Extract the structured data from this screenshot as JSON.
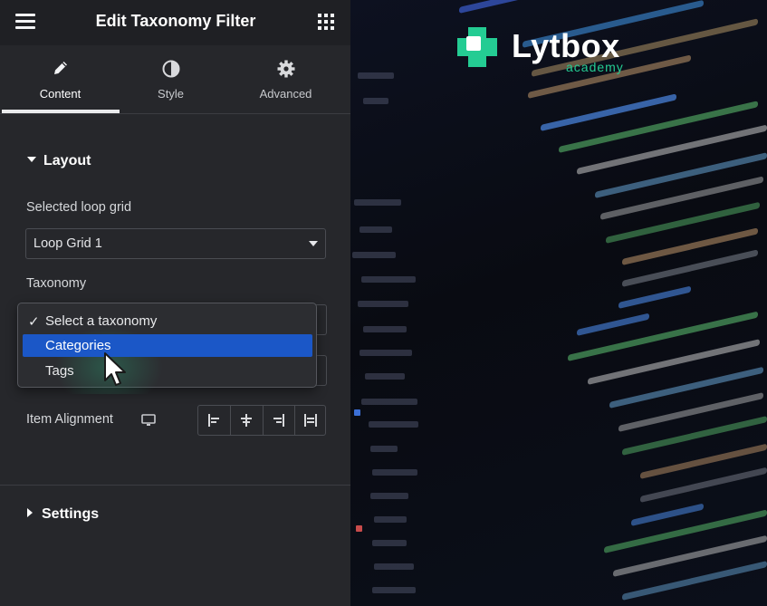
{
  "panel": {
    "title": "Edit Taxonomy Filter",
    "tabs": [
      {
        "label": "Content",
        "icon": "pencil-icon",
        "active": true
      },
      {
        "label": "Style",
        "icon": "half-circle-icon",
        "active": false
      },
      {
        "label": "Advanced",
        "icon": "gear-icon",
        "active": false
      }
    ],
    "layout_section": "Layout",
    "loop_grid_label": "Selected loop grid",
    "loop_grid_value": "Loop Grid 1",
    "taxonomy_label": "Taxonomy",
    "taxonomy_options": [
      {
        "label": "Select a taxonomy",
        "checked": true,
        "highlighted": false
      },
      {
        "label": "Categories",
        "checked": false,
        "highlighted": true
      },
      {
        "label": "Tags",
        "checked": false,
        "highlighted": false
      }
    ],
    "check_mark": "✓",
    "item_alignment_label": "Item Alignment",
    "alignment_buttons": [
      "align-start-icon",
      "align-center-icon",
      "align-end-icon",
      "align-stretch-icon"
    ],
    "settings_section": "Settings"
  },
  "logo": {
    "word": "Lytbox",
    "sub": "academy",
    "brand_color": "#24cc93"
  },
  "colors": {
    "panel_bg": "#26272b",
    "topbar_bg": "#1f2024",
    "highlight": "#1b57c7"
  }
}
